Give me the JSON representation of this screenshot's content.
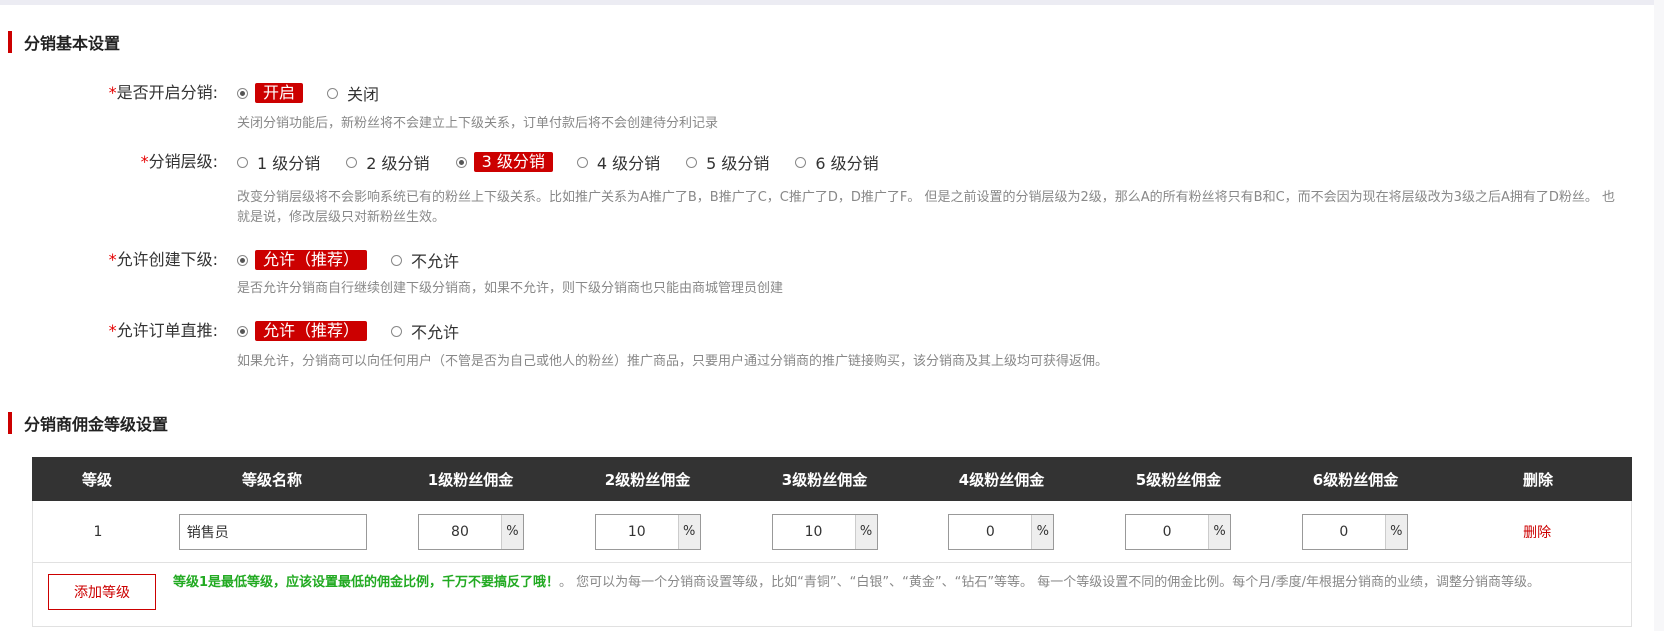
{
  "sections": {
    "basic_title": "分销基本设置",
    "commission_title": "分销商佣金等级设置"
  },
  "settings": {
    "enable": {
      "required_mark": "*",
      "label": "是否开启分销:",
      "options": [
        "开启",
        "关闭"
      ],
      "selected": 0,
      "help": "关闭分销功能后，新粉丝将不会建立上下级关系，订单付款后将不会创建待分利记录"
    },
    "levels": {
      "required_mark": "*",
      "label": "分销层级:",
      "options": [
        "1 级分销",
        "2 级分销",
        "3 级分销",
        "4 级分销",
        "5 级分销",
        "6 级分销"
      ],
      "selected": 2,
      "help": "改变分销层级将不会影响系统已有的粉丝上下级关系。比如推广关系为A推广了B，B推广了C，C推广了D，D推广了F。 但是之前设置的分销层级为2级，那么A的所有粉丝将只有B和C，而不会因为现在将层级改为3级之后A拥有了D粉丝。 也就是说，修改层级只对新粉丝生效。"
    },
    "allow_sub": {
      "required_mark": "*",
      "label": "允许创建下级:",
      "options": [
        "允许（推荐）",
        "不允许"
      ],
      "selected": 0,
      "help": "是否允许分销商自行继续创建下级分销商，如果不允许，则下级分销商也只能由商城管理员创建"
    },
    "direct_push": {
      "required_mark": "*",
      "label": "允许订单直推:",
      "options": [
        "允许（推荐）",
        "不允许"
      ],
      "selected": 0,
      "help": "如果允许，分销商可以向任何用户（不管是否为自己或他人的粉丝）推广商品，只要用户通过分销商的推广链接购买，该分销商及其上级均可获得返佣。"
    }
  },
  "table": {
    "headers": [
      "等级",
      "等级名称",
      "1级粉丝佣金",
      "2级粉丝佣金",
      "3级粉丝佣金",
      "4级粉丝佣金",
      "5级粉丝佣金",
      "6级粉丝佣金",
      "删除"
    ],
    "rows": [
      {
        "level": "1",
        "name": "销售员",
        "commissions": [
          "80",
          "10",
          "10",
          "0",
          "0",
          "0"
        ],
        "delete_label": "删除"
      }
    ],
    "percent_unit": "%",
    "add_button": "添加等级",
    "note_highlight": "等级1是最低等级，应该设置最低的佣金比例，千万不要搞反了哦！",
    "note_rest": "。 您可以为每一个分销商设置等级，比如“青铜”、“白银”、“黄金”、“钻石”等等。 每一个等级设置不同的佣金比例。每个月/季度/年根据分销商的业绩，调整分销商等级。"
  },
  "colors": {
    "accent": "#cc0000",
    "header_bg": "#333333",
    "note_green": "#22aa22",
    "help_text": "#888888"
  }
}
